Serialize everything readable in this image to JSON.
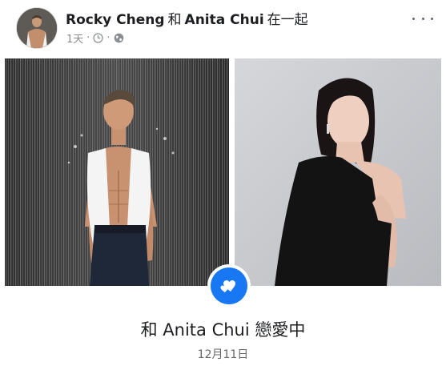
{
  "post": {
    "author": "Rocky Cheng",
    "with_joiner": "和",
    "tagged_person": "Anita Chui",
    "with_suffix": "在一起",
    "time_ago": "1天",
    "meta_separator": "·",
    "icons": {
      "clock": "clock-icon",
      "audience": "globe-icon",
      "more": "more-options-icon",
      "event": "hearts-icon"
    }
  },
  "life_event": {
    "title": "和 Anita Chui 戀愛中",
    "date": "12月11日"
  },
  "colors": {
    "brand_blue": "#1877f2",
    "text_primary": "#1c1e21",
    "text_secondary": "#65676b",
    "meta_gray": "#8a8d91"
  }
}
